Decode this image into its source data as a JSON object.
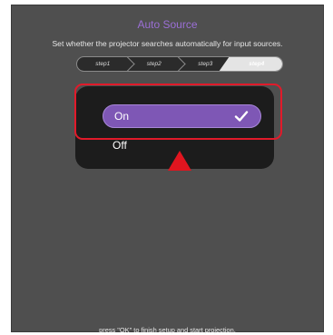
{
  "header": {
    "title": "Auto Source",
    "subtitle": "Set whether the projector searches automatically for input sources."
  },
  "steps": [
    {
      "label": "step1",
      "active": false
    },
    {
      "label": "step2",
      "active": false
    },
    {
      "label": "step3",
      "active": false
    },
    {
      "label": "step4",
      "active": true
    }
  ],
  "options": {
    "on_label": "On",
    "off_label": "Off",
    "selected": "On"
  },
  "footer": {
    "hint": "press \"OK\" to finish setup and start projection."
  },
  "colors": {
    "accent": "#7e57b5",
    "title": "#9b6fd6",
    "highlight": "#e11a2a"
  },
  "icons": {
    "selected_check": "check-icon",
    "indicator": "arrow-up-indicator"
  }
}
